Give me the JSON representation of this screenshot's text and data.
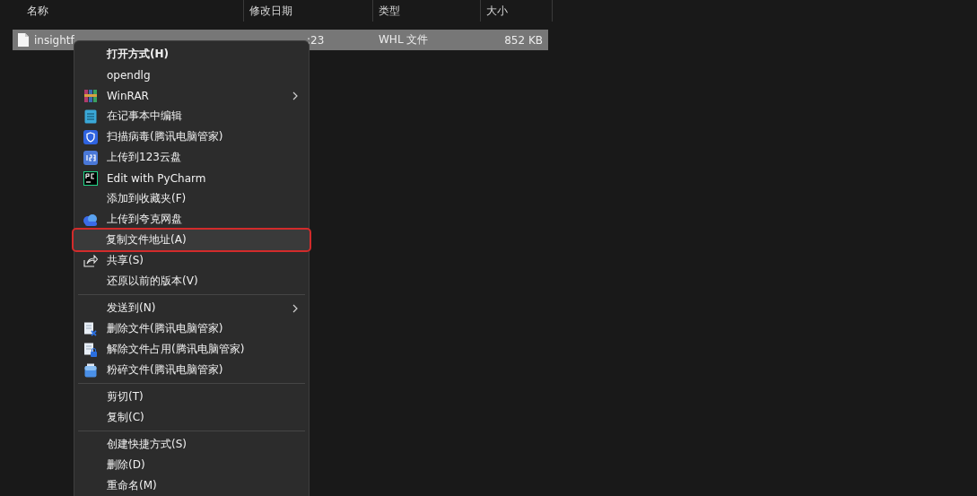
{
  "columns": [
    "名称",
    "修改日期",
    "类型",
    "大小"
  ],
  "file": {
    "name": "insightf",
    "modified": ":23",
    "type": "WHL 文件",
    "size": "852 KB",
    "selected": true
  },
  "menu": [
    {
      "kind": "plain",
      "label": "打开方式(H)",
      "bold": true,
      "submenu": false,
      "highlighted": false
    },
    {
      "kind": "plain",
      "label": "opendlg",
      "bold": false,
      "submenu": false,
      "highlighted": false
    },
    {
      "kind": "archive",
      "label": "WinRAR",
      "bold": false,
      "submenu": true,
      "highlighted": false
    },
    {
      "kind": "notepad",
      "label": "在记事本中编辑",
      "bold": false,
      "submenu": false,
      "highlighted": false
    },
    {
      "kind": "shield",
      "label": "扫描病毒(腾讯电脑管家)",
      "bold": false,
      "submenu": false,
      "highlighted": false
    },
    {
      "kind": "numbers",
      "label": "上传到123云盘",
      "bold": false,
      "submenu": false,
      "highlighted": false
    },
    {
      "kind": "pycharm",
      "label": "Edit with PyCharm",
      "bold": false,
      "submenu": false,
      "highlighted": false
    },
    {
      "kind": "plain",
      "label": "添加到收藏夹(F)",
      "bold": false,
      "submenu": false,
      "highlighted": false
    },
    {
      "kind": "cloud",
      "label": "上传到夸克网盘",
      "bold": false,
      "submenu": false,
      "highlighted": false
    },
    {
      "kind": "plain",
      "label": "复制文件地址(A)",
      "bold": false,
      "submenu": false,
      "highlighted": true
    },
    {
      "kind": "share",
      "label": "共享(S)",
      "bold": false,
      "submenu": false,
      "highlighted": false
    },
    {
      "kind": "plain",
      "label": "还原以前的版本(V)",
      "bold": false,
      "submenu": false,
      "highlighted": false
    },
    {
      "kind": "separator"
    },
    {
      "kind": "plain",
      "label": "发送到(N)",
      "bold": false,
      "submenu": true,
      "highlighted": false
    },
    {
      "kind": "deletefile",
      "label": "删除文件(腾讯电脑管家)",
      "bold": false,
      "submenu": false,
      "highlighted": false
    },
    {
      "kind": "unlockfile",
      "label": "解除文件占用(腾讯电脑管家)",
      "bold": false,
      "submenu": false,
      "highlighted": false
    },
    {
      "kind": "shredder",
      "label": "粉碎文件(腾讯电脑管家)",
      "bold": false,
      "submenu": false,
      "highlighted": false
    },
    {
      "kind": "separator"
    },
    {
      "kind": "plain",
      "label": "剪切(T)",
      "bold": false,
      "submenu": false,
      "highlighted": false
    },
    {
      "kind": "plain",
      "label": "复制(C)",
      "bold": false,
      "submenu": false,
      "highlighted": false
    },
    {
      "kind": "separator"
    },
    {
      "kind": "plain",
      "label": "创建快捷方式(S)",
      "bold": false,
      "submenu": false,
      "highlighted": false
    },
    {
      "kind": "plain",
      "label": "删除(D)",
      "bold": false,
      "submenu": false,
      "highlighted": false
    },
    {
      "kind": "plain",
      "label": "重命名(M)",
      "bold": false,
      "submenu": false,
      "highlighted": false
    }
  ]
}
